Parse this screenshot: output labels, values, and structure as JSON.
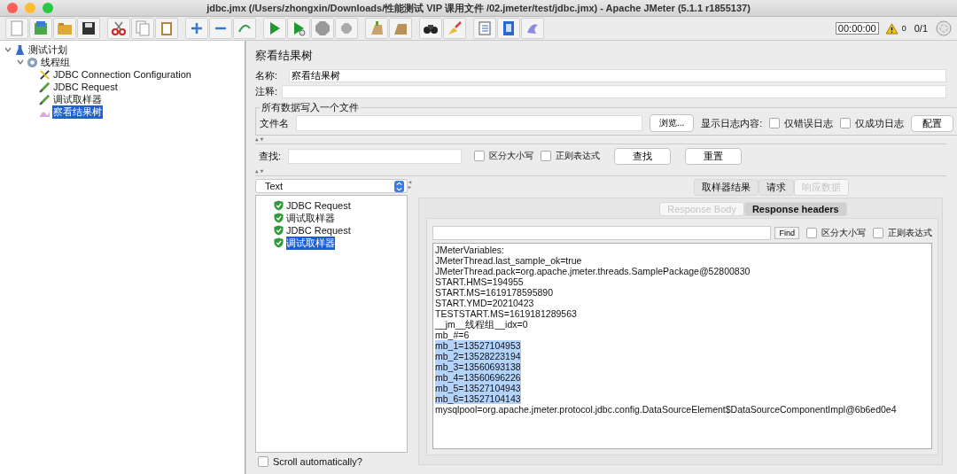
{
  "window": {
    "title": "jdbc.jmx (/Users/zhongxin/Downloads/性能测试 VIP 课用文件 /02.jmeter/test/jdbc.jmx) - Apache JMeter (5.1.1 r1855137)"
  },
  "toolbar": {
    "timer": "00:00:00",
    "warnings": "0",
    "threads": "0/1"
  },
  "tree": [
    {
      "label": "测试计划",
      "kind": "plan",
      "expanded": true,
      "selected": false,
      "children": [
        {
          "label": "线程组",
          "kind": "group",
          "expanded": true,
          "selected": false,
          "children": [
            {
              "label": "JDBC Connection Configuration",
              "kind": "config",
              "selected": false
            },
            {
              "label": "JDBC Request",
              "kind": "sampler",
              "selected": false
            },
            {
              "label": "调试取样器",
              "kind": "sampler",
              "selected": false
            },
            {
              "label": "察看结果树",
              "kind": "listener",
              "selected": true
            }
          ]
        }
      ]
    }
  ],
  "panel": {
    "title": "察看结果树",
    "name_label": "名称:",
    "name_value": "察看结果树",
    "comment_label": "注释:",
    "file_group": {
      "title": "所有数据写入一个文件",
      "file_label": "文件名",
      "browse": "浏览...",
      "log_label": "显示日志内容:",
      "options": [
        {
          "label": "仅错误日志",
          "checked": false
        },
        {
          "label": "仅成功日志",
          "checked": false
        }
      ],
      "config": "配置"
    },
    "search": {
      "label": "查找:",
      "options": [
        {
          "label": "区分大小写",
          "checked": false
        },
        {
          "label": "正则表达式",
          "checked": false
        }
      ],
      "buttons": [
        "查找",
        "重置"
      ]
    }
  },
  "renderer": {
    "value": "Text"
  },
  "results": [
    {
      "label": "JDBC Request",
      "selected": false
    },
    {
      "label": "调试取样器",
      "selected": false
    },
    {
      "label": "JDBC Request",
      "selected": false
    },
    {
      "label": "调试取样器",
      "selected": true
    }
  ],
  "result_tabs": [
    {
      "label": "取样器结果",
      "selected": false,
      "disabled": false
    },
    {
      "label": "请求",
      "selected": false,
      "disabled": false
    },
    {
      "label": "响应数据",
      "selected": false,
      "disabled": true
    }
  ],
  "sub_tabs": [
    {
      "label": "Response Body",
      "selected": false,
      "disabled": true
    },
    {
      "label": "Response headers",
      "selected": true,
      "disabled": false
    }
  ],
  "find": {
    "button": "Find",
    "options": [
      {
        "label": "区分大小写",
        "checked": false
      },
      {
        "label": "正则表达式",
        "checked": false
      }
    ]
  },
  "content": [
    {
      "text": "JMeterVariables:",
      "highlighted": false
    },
    {
      "text": "JMeterThread.last_sample_ok=true",
      "highlighted": false
    },
    {
      "text": "JMeterThread.pack=org.apache.jmeter.threads.SamplePackage@52800830",
      "highlighted": false
    },
    {
      "text": "START.HMS=194955",
      "highlighted": false
    },
    {
      "text": "START.MS=1619178595890",
      "highlighted": false
    },
    {
      "text": "START.YMD=20210423",
      "highlighted": false
    },
    {
      "text": "TESTSTART.MS=1619181289563",
      "highlighted": false
    },
    {
      "text": "__jm__线程组__idx=0",
      "highlighted": false
    },
    {
      "text": "mb_#=6",
      "highlighted": false
    },
    {
      "text": "mb_1=13527104953",
      "highlighted": true
    },
    {
      "text": "mb_2=13528223194",
      "highlighted": true
    },
    {
      "text": "mb_3=13560693138",
      "highlighted": true
    },
    {
      "text": "mb_4=13560696226",
      "highlighted": true
    },
    {
      "text": "mb_5=13527104943",
      "highlighted": true
    },
    {
      "text": "mb_6=13527104143",
      "highlighted": true
    },
    {
      "text": "mysqlpool=org.apache.jmeter.protocol.jdbc.config.DataSourceElement$DataSourceComponentImpl@6b6ed0e4",
      "highlighted": false
    }
  ],
  "scroll_auto": {
    "label": "Scroll automatically?",
    "checked": false
  }
}
